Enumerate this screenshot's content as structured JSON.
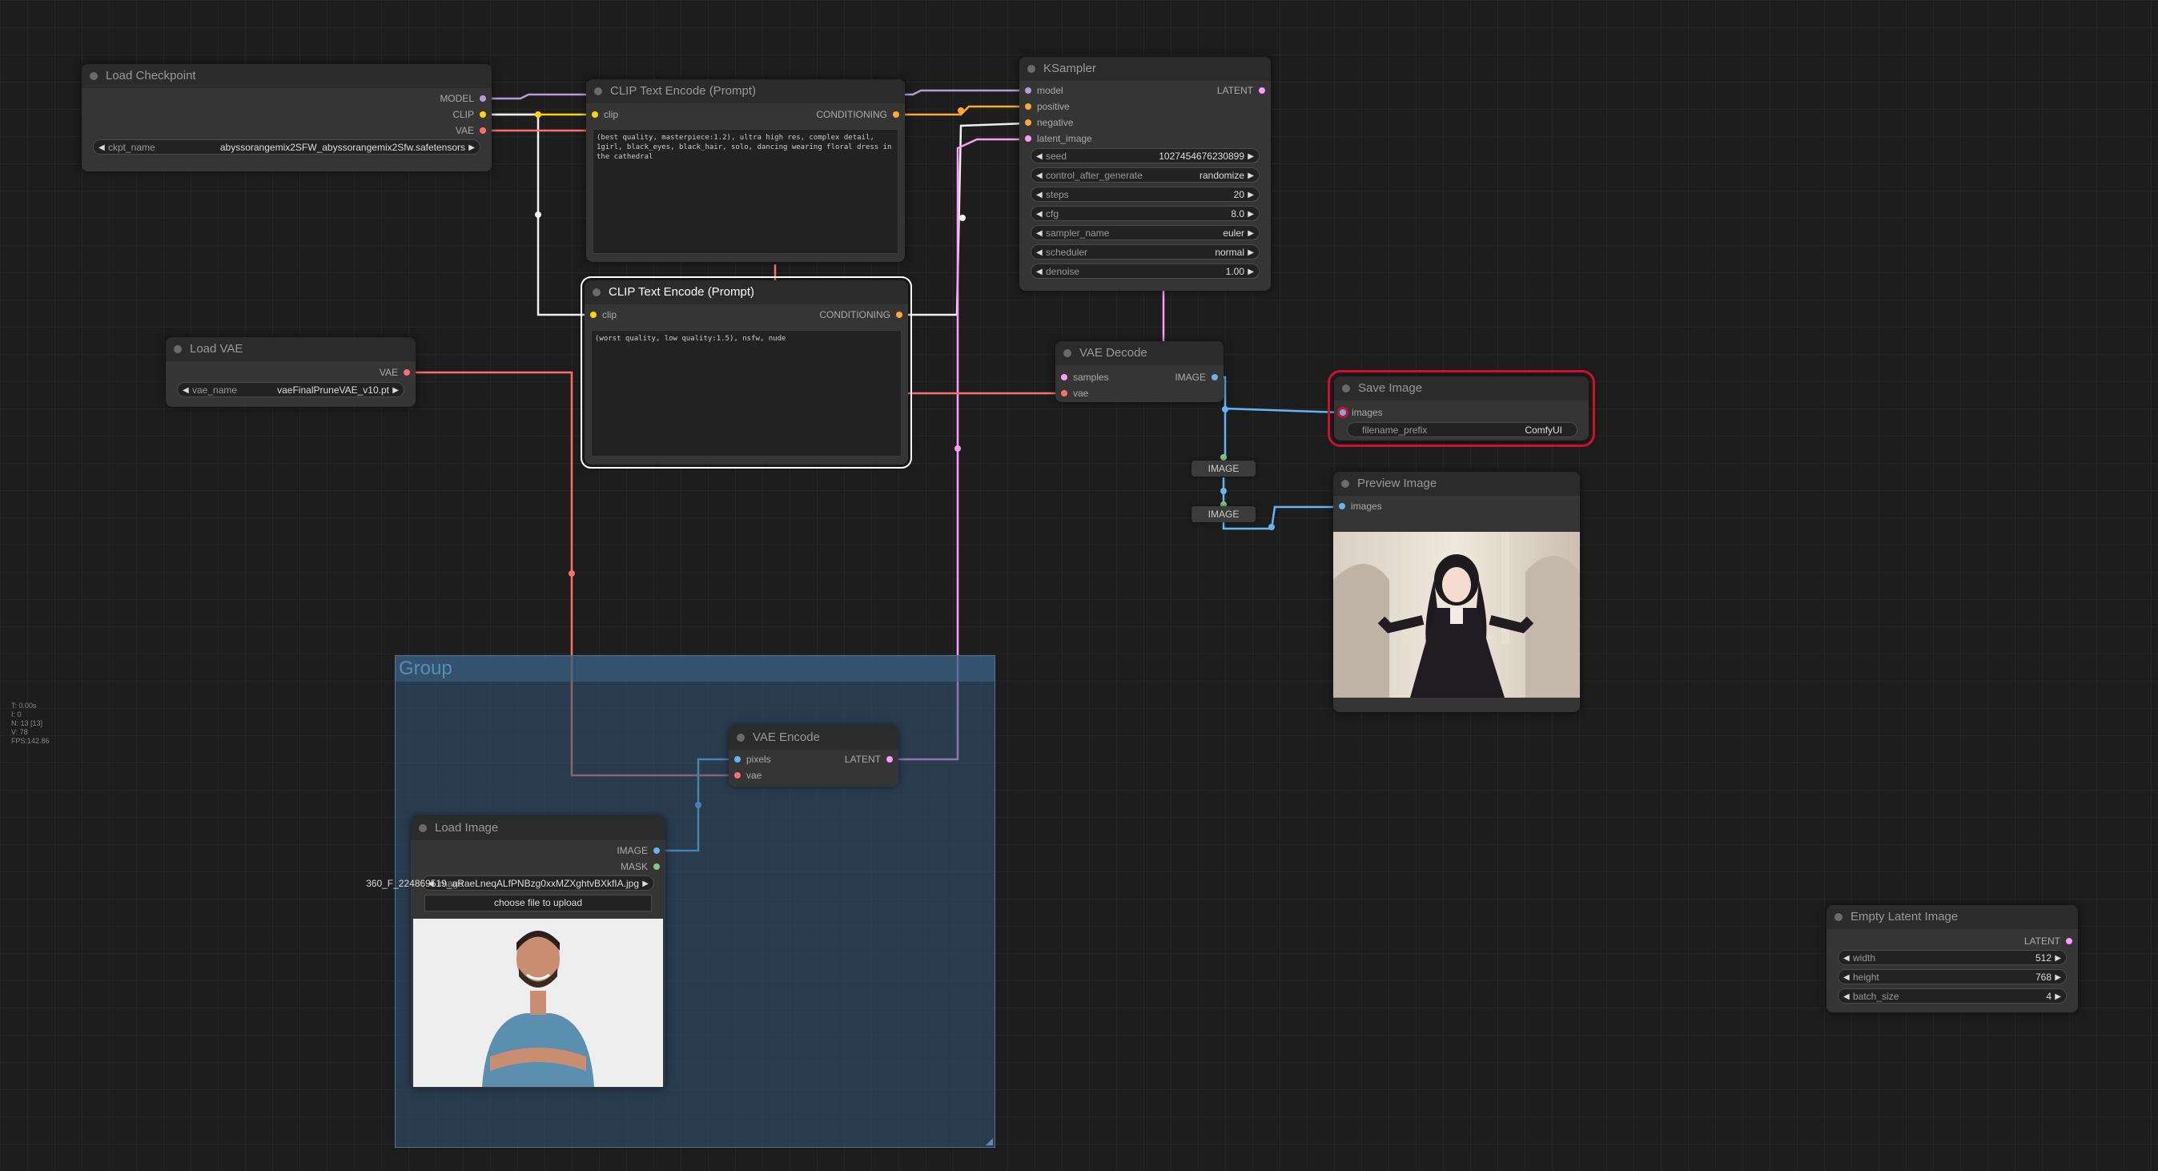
{
  "stats": {
    "t": "T: 0.00s",
    "i": "I: 0",
    "n": "N: 13 [13]",
    "v": "V: 78",
    "fps": "FPS:142.86"
  },
  "colors": {
    "model": "#b39ddb",
    "clip": "#ffd500",
    "vae": "#ff6e6e",
    "conditioning": "#ffa931",
    "latent": "#ff9cf9",
    "image": "#64b5f6",
    "mask": "#81c784"
  },
  "group": {
    "title": "Group"
  },
  "load_checkpoint": {
    "title": "Load Checkpoint",
    "out_model": "MODEL",
    "out_clip": "CLIP",
    "out_vae": "VAE",
    "ckpt_label": "ckpt_name",
    "ckpt_value": "abyssorangemix2SFW_abyssorangemix2Sfw.safetensors"
  },
  "clip_pos": {
    "title": "CLIP Text Encode (Prompt)",
    "in_clip": "clip",
    "out": "CONDITIONING",
    "text": "(best quality, masterpiece:1.2), ultra high res, complex detail, 1girl, black_eyes, black_hair, solo, dancing wearing floral dress in the cathedral"
  },
  "clip_neg": {
    "title": "CLIP Text Encode (Prompt)",
    "in_clip": "clip",
    "out": "CONDITIONING",
    "text": "(worst quality, low quality:1.5), nsfw, nude"
  },
  "load_vae": {
    "title": "Load VAE",
    "out_vae": "VAE",
    "label": "vae_name",
    "value": "vaeFinalPruneVAE_v10.pt"
  },
  "ksampler": {
    "title": "KSampler",
    "in_model": "model",
    "in_positive": "positive",
    "in_negative": "negative",
    "in_latent": "latent_image",
    "out": "LATENT",
    "widgets": [
      {
        "label": "seed",
        "value": "1027454676230899"
      },
      {
        "label": "control_after_generate",
        "value": "randomize"
      },
      {
        "label": "steps",
        "value": "20"
      },
      {
        "label": "cfg",
        "value": "8.0"
      },
      {
        "label": "sampler_name",
        "value": "euler"
      },
      {
        "label": "scheduler",
        "value": "normal"
      },
      {
        "label": "denoise",
        "value": "1.00"
      }
    ]
  },
  "vae_decode": {
    "title": "VAE Decode",
    "in_samples": "samples",
    "in_vae": "vae",
    "out": "IMAGE"
  },
  "save_image": {
    "title": "Save Image",
    "in_images": "images",
    "label": "filename_prefix",
    "value": "ComfyUI"
  },
  "reroute1": {
    "label": "IMAGE"
  },
  "reroute2": {
    "label": "IMAGE"
  },
  "preview_image": {
    "title": "Preview Image",
    "in_images": "images"
  },
  "vae_encode": {
    "title": "VAE Encode",
    "in_pixels": "pixels",
    "in_vae": "vae",
    "out": "LATENT"
  },
  "load_image": {
    "title": "Load Image",
    "out_image": "IMAGE",
    "out_mask": "MASK",
    "image_label": "image",
    "filename": "360_F_224869519_aRaeLneqALfPNBzg0xxMZXghtvBXkfIA.jpg",
    "button": "choose file to upload"
  },
  "empty_latent": {
    "title": "Empty Latent Image",
    "out": "LATENT",
    "widgets": [
      {
        "label": "width",
        "value": "512"
      },
      {
        "label": "height",
        "value": "768"
      },
      {
        "label": "batch_size",
        "value": "4"
      }
    ]
  }
}
